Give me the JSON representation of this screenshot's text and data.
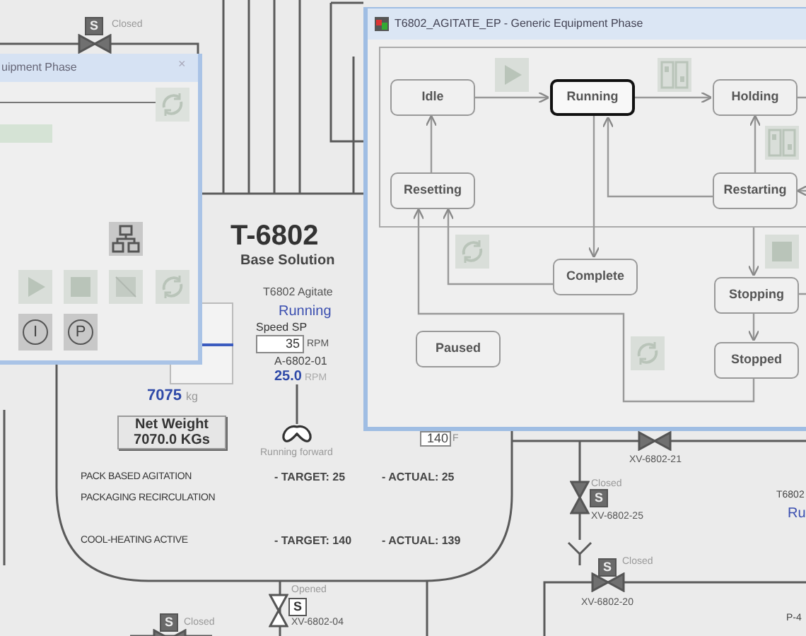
{
  "left_window": {
    "title": "uipment Phase",
    "close": "×",
    "letter_buttons": [
      "I",
      "P"
    ]
  },
  "state_window": {
    "title": "T6802_AGITATE_EP - Generic Equipment Phase",
    "states": [
      {
        "label": "Idle",
        "selected": false
      },
      {
        "label": "Running",
        "selected": true
      },
      {
        "label": "Holding",
        "selected": false
      },
      {
        "label": "Resetting",
        "selected": false
      },
      {
        "label": "Restarting",
        "selected": false
      },
      {
        "label": "Complete",
        "selected": false
      },
      {
        "label": "Stopping",
        "selected": false
      },
      {
        "label": "Paused",
        "selected": false
      },
      {
        "label": "Stopped",
        "selected": false
      }
    ]
  },
  "tank": {
    "name": "T-6802",
    "description": "Base Solution",
    "weight": "7075",
    "weight_unit": "kg",
    "net_weight": [
      "Net Weight",
      "7070.0 KGs"
    ],
    "temperature_sp": "140",
    "temperature_unit": "F"
  },
  "agitator": {
    "label": "T6802 Agitate",
    "status": "Running",
    "speed_sp_label": "Speed SP",
    "speed_sp": "35",
    "speed_sp_unit": "RPM",
    "tag": "A-6802-01",
    "speed": "25.0",
    "speed_unit": "RPM",
    "direction": "Running forward"
  },
  "process_rows": [
    {
      "label": "PACK BASED AGITATION",
      "target": "- TARGET: 25",
      "actual": "- ACTUAL: 25"
    },
    {
      "label": "PACKAGING RECIRCULATION"
    },
    {
      "label": "COOL-HEATING ACTIVE",
      "target": "- TARGET: 140",
      "actual": "- ACTUAL: 139"
    }
  ],
  "valves": [
    {
      "status": "Closed",
      "open": false,
      "actuator": "S",
      "kind": "horizontal"
    },
    {
      "tag": "XV-6802-21",
      "open": false,
      "kind": "horizontal"
    },
    {
      "tag": "XV-6802-25",
      "status": "Closed",
      "open": false,
      "actuator": "S",
      "kind": "vertical"
    },
    {
      "tag": "XV-6802-20",
      "status": "Closed",
      "open": false,
      "actuator": "S",
      "kind": "horizontal"
    },
    {
      "status": "Closed",
      "open": false,
      "actuator": "S",
      "kind": "horizontal"
    },
    {
      "tag": "XV-6802-04",
      "status": "Opened",
      "open": true,
      "actuator": "S",
      "kind": "vertical"
    }
  ],
  "right_edge": {
    "label": "T6802",
    "status": "Ru",
    "pump_tag": "P-4"
  }
}
